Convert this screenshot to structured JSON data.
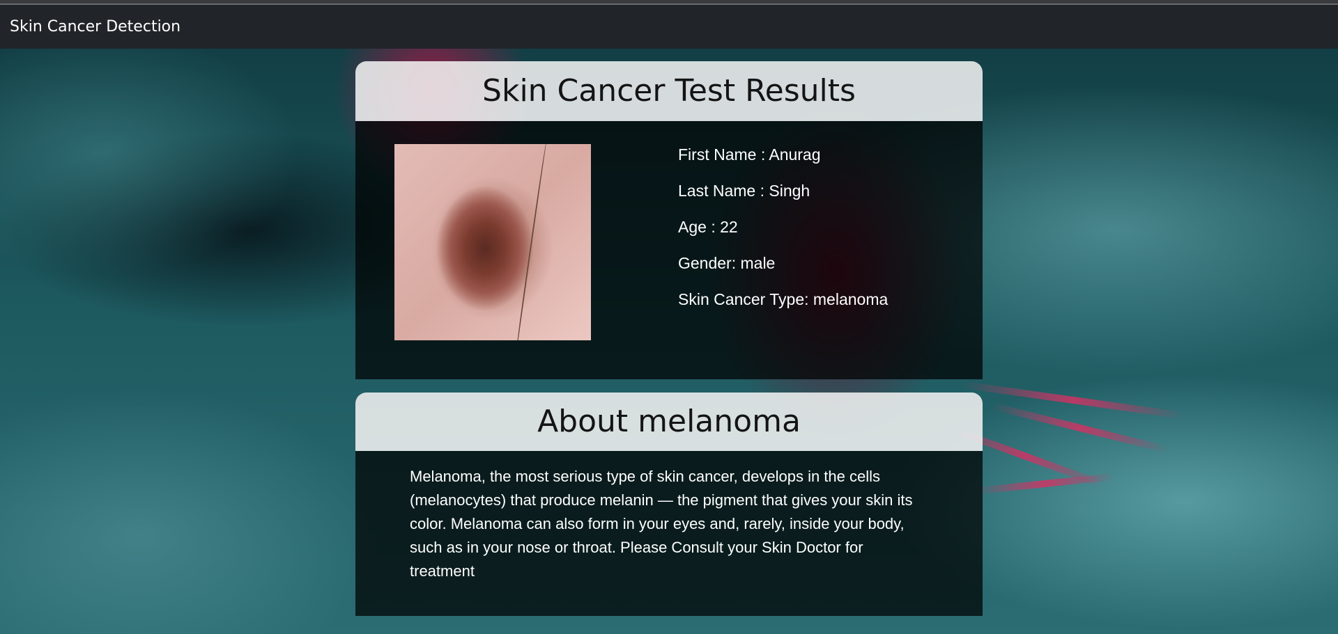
{
  "navbar": {
    "brand": "Skin Cancer Detection"
  },
  "results": {
    "title": "Skin Cancer Test Results",
    "first_name": "First Name : Anurag",
    "last_name": "Last Name : Singh",
    "age": "Age : 22",
    "gender": "Gender: male",
    "cancer_type": "Skin Cancer Type: melanoma"
  },
  "about": {
    "title": "About melanoma",
    "text": "Melanoma, the most serious type of skin cancer, develops in the cells (melanocytes) that produce melanin — the pigment that gives your skin its color. Melanoma can also form in your eyes and, rarely, inside your body, such as in your nose or throat. Please Consult your Skin Doctor for treatment"
  }
}
